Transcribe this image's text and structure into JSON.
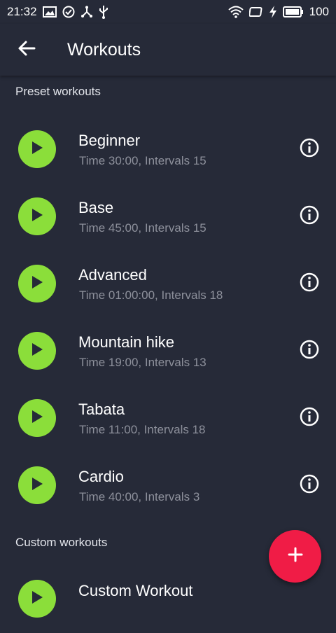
{
  "status_bar": {
    "time": "21:32",
    "battery": "100",
    "icons": [
      "image-icon",
      "check-circle-icon",
      "network-share-icon",
      "usb-icon",
      "wifi-icon",
      "screen-icon",
      "charging-icon",
      "battery-icon"
    ]
  },
  "app_bar": {
    "title": "Workouts",
    "back_icon": "arrow-left-icon"
  },
  "preset_section": {
    "title": "Preset workouts",
    "items": [
      {
        "name": "Beginner",
        "meta": "Time 30:00, Intervals 15"
      },
      {
        "name": "Base",
        "meta": "Time 45:00, Intervals 15"
      },
      {
        "name": "Advanced",
        "meta": "Time 01:00:00, Intervals 18"
      },
      {
        "name": "Mountain hike",
        "meta": "Time 19:00, Intervals 13"
      },
      {
        "name": "Tabata",
        "meta": "Time 11:00, Intervals 18"
      },
      {
        "name": "Cardio",
        "meta": "Time 40:00, Intervals 3"
      }
    ]
  },
  "custom_section": {
    "title": "Custom workouts",
    "items": [
      {
        "name": "Custom Workout"
      }
    ]
  },
  "fab": {
    "icon": "plus-icon"
  },
  "colors": {
    "background": "#262a38",
    "play_button": "#8bde3a",
    "fab": "#f01c46",
    "meta_text": "#8d909b"
  }
}
